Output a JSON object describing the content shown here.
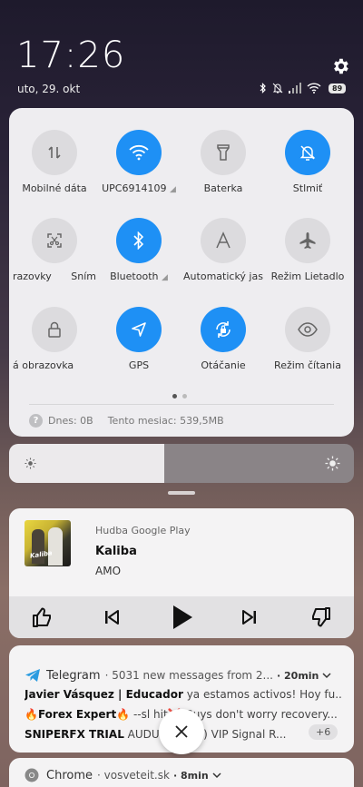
{
  "status_bar": {
    "time": "17:26",
    "date": "uto, 29. okt",
    "battery": "89"
  },
  "quick_settings": {
    "tiles": [
      {
        "label": "Mobilné dáta",
        "icon": "mobile-data-icon",
        "on": false
      },
      {
        "label": "UPC6914109",
        "icon": "wifi-icon",
        "on": true
      },
      {
        "label": "Baterka",
        "icon": "flashlight-icon",
        "on": false
      },
      {
        "label": "Stlmiť",
        "icon": "mute-bell-icon",
        "on": true
      },
      {
        "label": "razovky",
        "label2": "Sním",
        "icon": "screenshot-icon",
        "on": false
      },
      {
        "label": "Bluetooth",
        "icon": "bluetooth-icon",
        "on": true
      },
      {
        "label": "Automatický jas",
        "icon": "auto-brightness-icon",
        "on": false
      },
      {
        "label": "Režim Lietadlo",
        "icon": "airplane-icon",
        "on": false
      },
      {
        "label": "á obrazovka",
        "icon": "lock-icon",
        "on": false
      },
      {
        "label": "GPS",
        "icon": "location-icon",
        "on": true
      },
      {
        "label": "Otáčanie",
        "icon": "rotation-icon",
        "on": true
      },
      {
        "label": "Režim čítania",
        "icon": "eye-icon",
        "on": false
      }
    ],
    "page_dots": 2,
    "active_dot": 0,
    "data_today": "Dnes: 0B",
    "data_month": "Tento mesiac: 539,5MB",
    "accent_color": "#1e90f5"
  },
  "brightness": {
    "level": 0.45
  },
  "music": {
    "app": "Hudba Google Play",
    "title": "Kaliba",
    "artist": "AMO",
    "album_text": "Kaliba"
  },
  "telegram": {
    "app": "Telegram",
    "summary": "· 5031 new messages from 2...",
    "time": "· 20min",
    "lines": [
      {
        "sender": "Javier Vásquez | Educador",
        "text": " ya estamos activos! Hoy fu..."
      },
      {
        "sender": "🔥Forex Expert🔥",
        "text": " --sl hit❌ Guys don't worry recovery..."
      },
      {
        "sender": "SNIPERFX TRIAL",
        "text": " AUDUSD (Act.) VIP Signal R..."
      }
    ],
    "more": "+6"
  },
  "chrome": {
    "app": "Chrome",
    "site": "· vosveteit.sk",
    "time": "· 8min"
  }
}
